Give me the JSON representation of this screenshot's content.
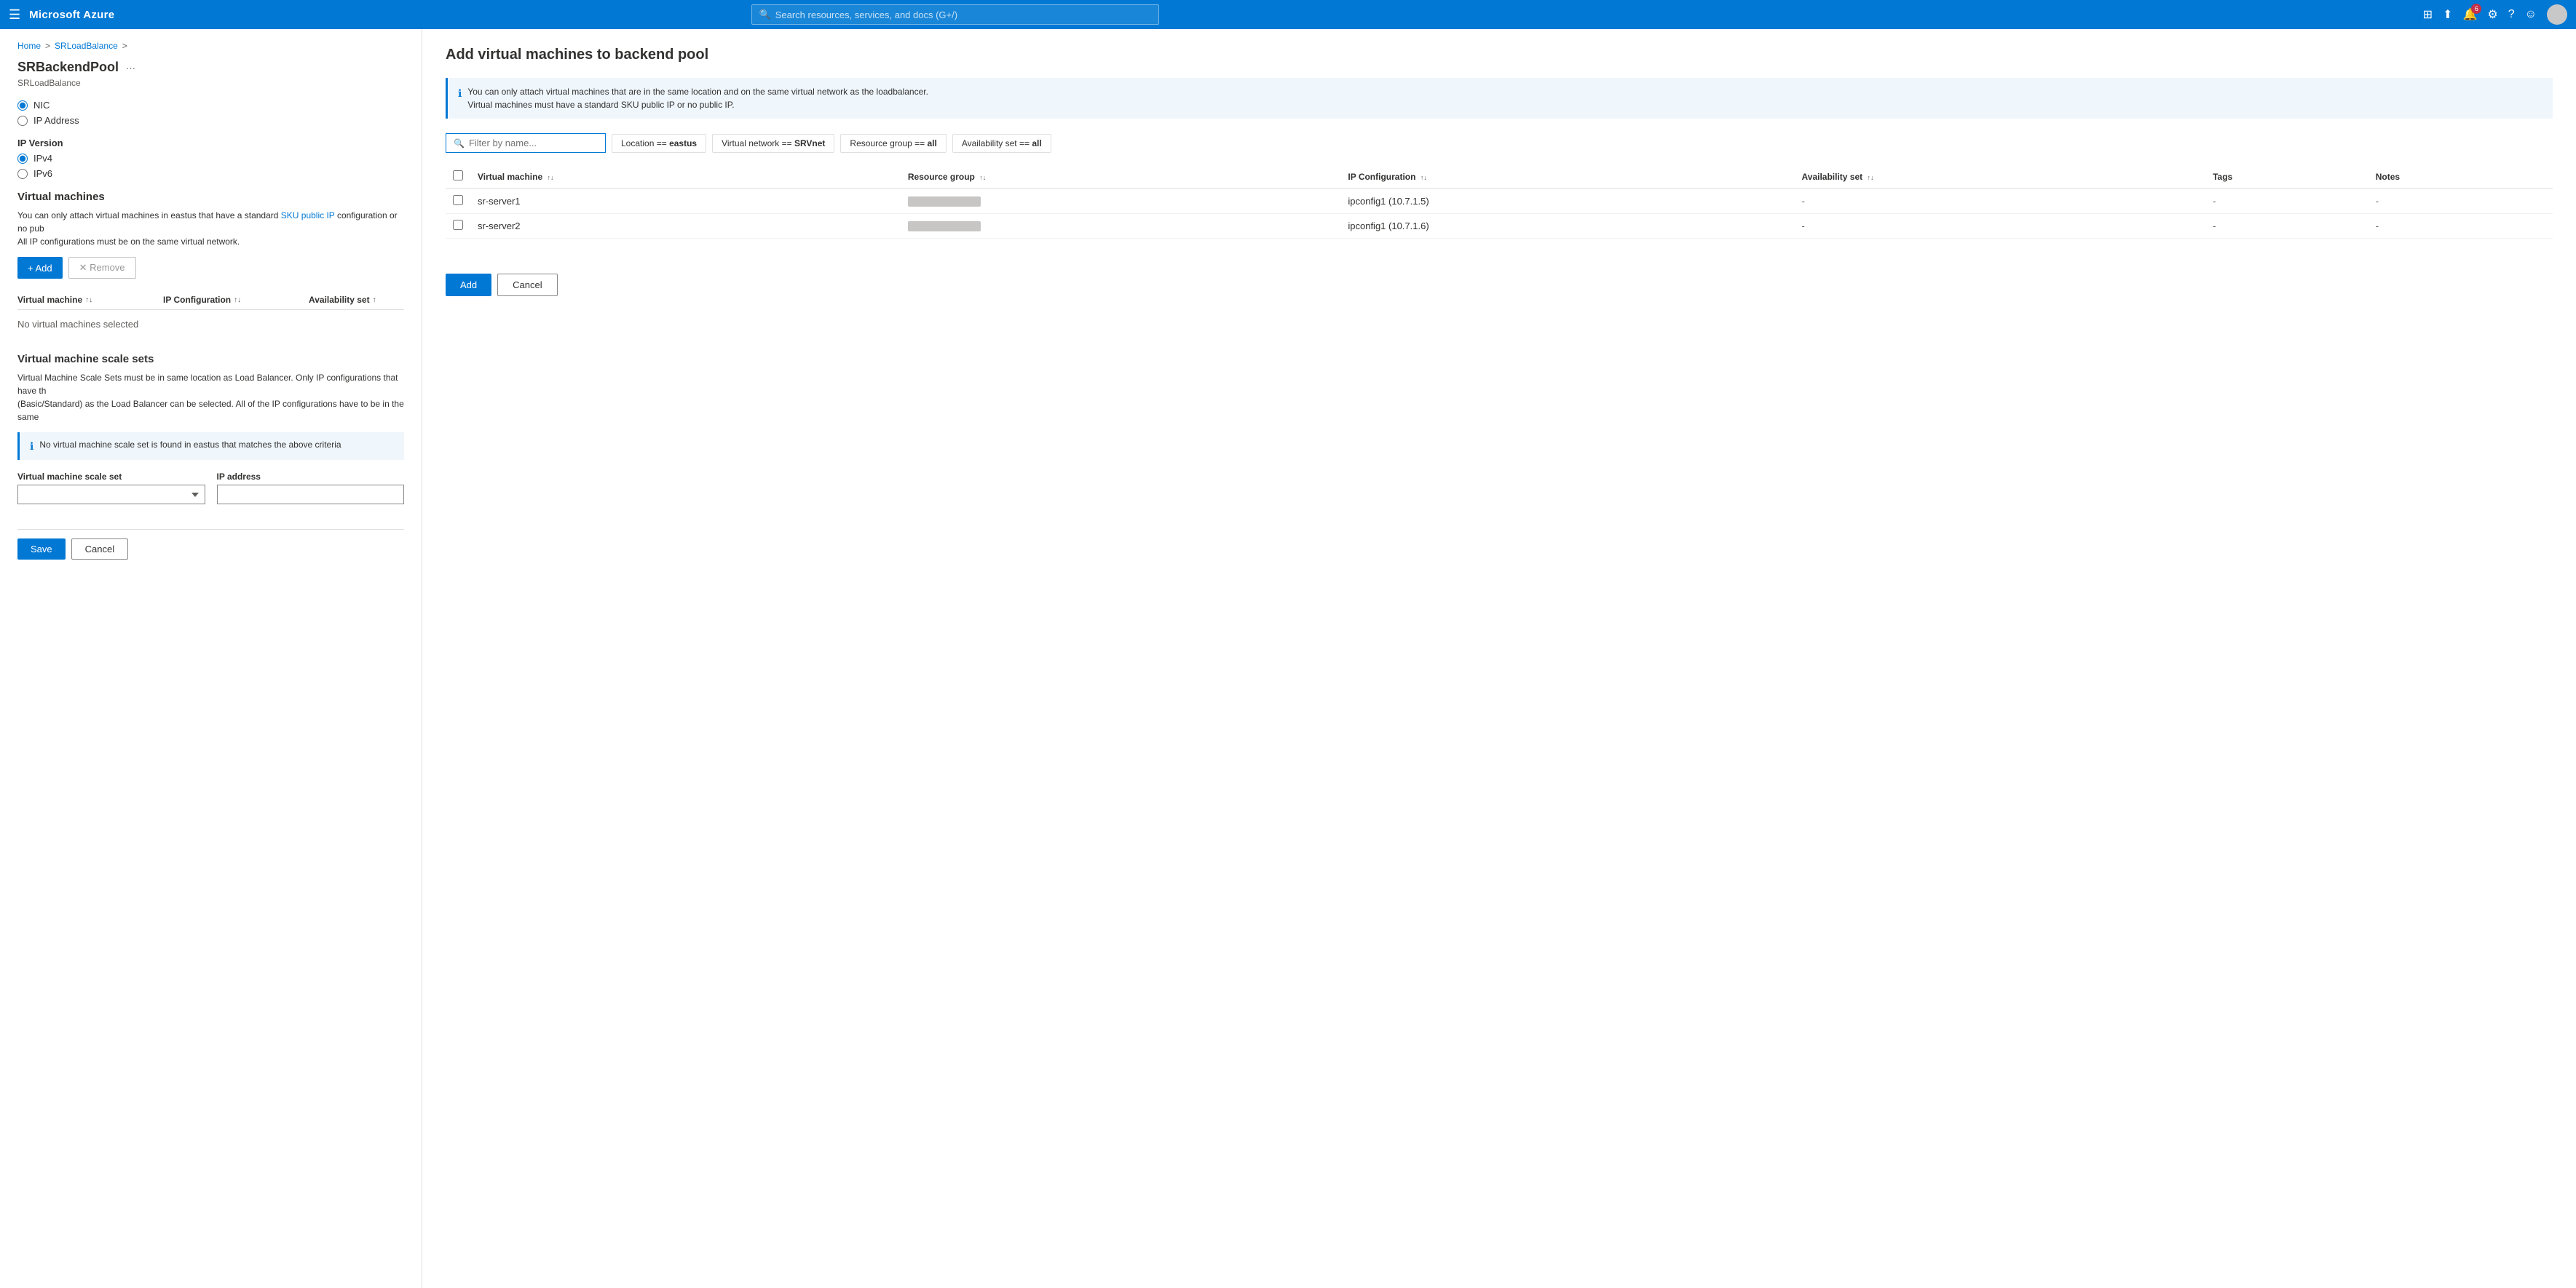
{
  "topnav": {
    "hamburger": "☰",
    "brand": "Microsoft Azure",
    "search_placeholder": "Search resources, services, and docs (G+/)",
    "notification_count": "6",
    "icons": {
      "portal": "⊞",
      "upload": "⬆",
      "notifications": "🔔",
      "settings": "⚙",
      "help": "?",
      "feedback": "☺"
    }
  },
  "breadcrumb": {
    "home": "Home",
    "separator1": ">",
    "parent": "SRLoadBalance",
    "separator2": ">"
  },
  "left_panel": {
    "title": "SRBackendPool",
    "subtitle": "SRLoadBalance",
    "more_icon": "···",
    "nic_label": "NIC",
    "ip_address_label": "IP Address",
    "ip_version_section": "IP Version",
    "ipv4_label": "IPv4",
    "ipv6_label": "IPv6",
    "vm_section_title": "Virtual machines",
    "vm_desc_part1": "You can only attach virtual machines in eastus that have a standard SKU public IP configuration or no pub",
    "vm_desc_part2": "All IP configurations must be on the same virtual network.",
    "sku_link": "SKU public IP",
    "add_button": "+ Add",
    "remove_button": "✕ Remove",
    "table_headers": {
      "virtual_machine": "Virtual machine",
      "ip_configuration": "IP Configuration",
      "availability_set": "Availability set"
    },
    "no_vms_message": "No virtual machines selected",
    "vmss_section_title": "Virtual machine scale sets",
    "vmss_desc_part1": "Virtual Machine Scale Sets must be in same location as Load Balancer. Only IP configurations that have th",
    "vmss_desc_part2": "(Basic/Standard) as the Load Balancer can be selected. All of the IP configurations have to be in the same",
    "vmss_info": "No virtual machine scale set is found in eastus that matches the above criteria",
    "vmss_scale_set_label": "Virtual machine scale set",
    "vmss_ip_label": "IP address",
    "save_button": "Save",
    "cancel_button": "Cancel"
  },
  "right_panel": {
    "title": "Add virtual machines to backend pool",
    "info_text_line1": "You can only attach virtual machines that are in the same location and on the same virtual network as the loadbalancer.",
    "info_text_line2": "Virtual machines must have a standard SKU public IP or no public IP.",
    "filter_placeholder": "Filter by name...",
    "filters": [
      {
        "label": "Location == ",
        "value": "eastus"
      },
      {
        "label": "Virtual network == ",
        "value": "SRVnet"
      },
      {
        "label": "Resource group == ",
        "value": "all"
      },
      {
        "label": "Availability set == ",
        "value": "all"
      }
    ],
    "table_columns": [
      {
        "name": "Virtual machine",
        "key": "virtual_machine"
      },
      {
        "name": "Resource group",
        "key": "resource_group"
      },
      {
        "name": "IP Configuration",
        "key": "ip_configuration"
      },
      {
        "name": "Availability set",
        "key": "availability_set"
      },
      {
        "name": "Tags",
        "key": "tags"
      },
      {
        "name": "Notes",
        "key": "notes"
      }
    ],
    "rows": [
      {
        "id": 1,
        "virtual_machine": "sr-server1",
        "resource_group": "",
        "ip_configuration": "ipconfig1 (10.7.1.5)",
        "availability_set": "-",
        "tags": "-",
        "notes": "-"
      },
      {
        "id": 2,
        "virtual_machine": "sr-server2",
        "resource_group": "",
        "ip_configuration": "ipconfig1 (10.7.1.6)",
        "availability_set": "-",
        "tags": "-",
        "notes": "-"
      }
    ],
    "add_button": "Add",
    "cancel_button": "Cancel"
  }
}
